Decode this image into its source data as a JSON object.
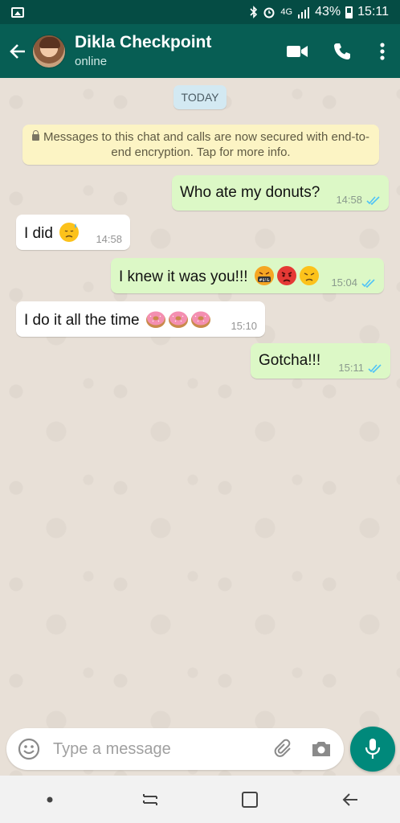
{
  "status_bar": {
    "network": "4G",
    "battery": "43%",
    "time": "15:11"
  },
  "header": {
    "contact_name": "Dikla Checkpoint",
    "contact_status": "online",
    "icons": [
      "back-arrow-icon",
      "video-call-icon",
      "phone-icon",
      "more-vert-icon"
    ]
  },
  "chat": {
    "date_chip": "TODAY",
    "encryption_notice": "Messages to this chat and calls are now secured with end-to-end encryption. Tap for more info.",
    "messages": [
      {
        "direction": "out",
        "text": "Who ate my donuts?",
        "time": "14:58",
        "status": "read"
      },
      {
        "direction": "in",
        "text": "I did",
        "emoji": [
          "sweat-face"
        ],
        "time": "14:58"
      },
      {
        "direction": "out",
        "text": "I knew it was you!!!",
        "emoji": [
          "cursing-face",
          "angry-face",
          "annoyed-face"
        ],
        "time": "15:04",
        "status": "read"
      },
      {
        "direction": "in",
        "text": "I do it all the time",
        "emoji": [
          "donut",
          "donut",
          "donut"
        ],
        "time": "15:10"
      },
      {
        "direction": "out",
        "text": "Gotcha!!!",
        "time": "15:11",
        "status": "read"
      }
    ]
  },
  "input": {
    "placeholder": "Type a message"
  },
  "colors": {
    "header": "#075e54",
    "outgoing_bubble": "#dcf8c6",
    "incoming_bubble": "#ffffff",
    "accent": "#00897b",
    "read_ticks": "#4fc3f7"
  }
}
